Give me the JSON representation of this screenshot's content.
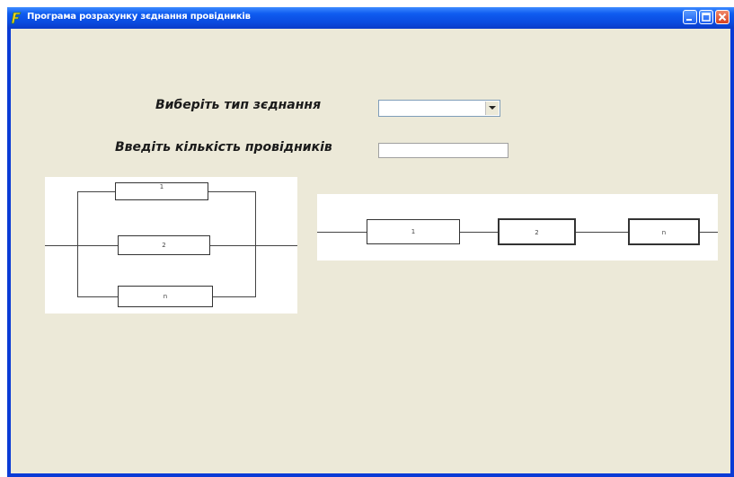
{
  "window": {
    "title": "Програма розрахунку зєднання провідників",
    "buttons": [
      "minimize",
      "maximize",
      "close"
    ]
  },
  "form": {
    "connection_type_label": "Виберіть тип зєднання",
    "connection_type_value": "",
    "conductor_count_label": "Введіть кількість провідників",
    "conductor_count_value": ""
  },
  "diagrams": {
    "parallel": {
      "resistors": [
        "1",
        "2",
        "n"
      ]
    },
    "series": {
      "resistors": [
        "1",
        "2",
        "n"
      ]
    }
  },
  "icons": {
    "app": "app-icon",
    "combo_arrow": "chevron-down-icon"
  },
  "colors": {
    "titlebar": "#0a4be0",
    "client_background": "#ece9d8",
    "close_button": "#d64020"
  }
}
